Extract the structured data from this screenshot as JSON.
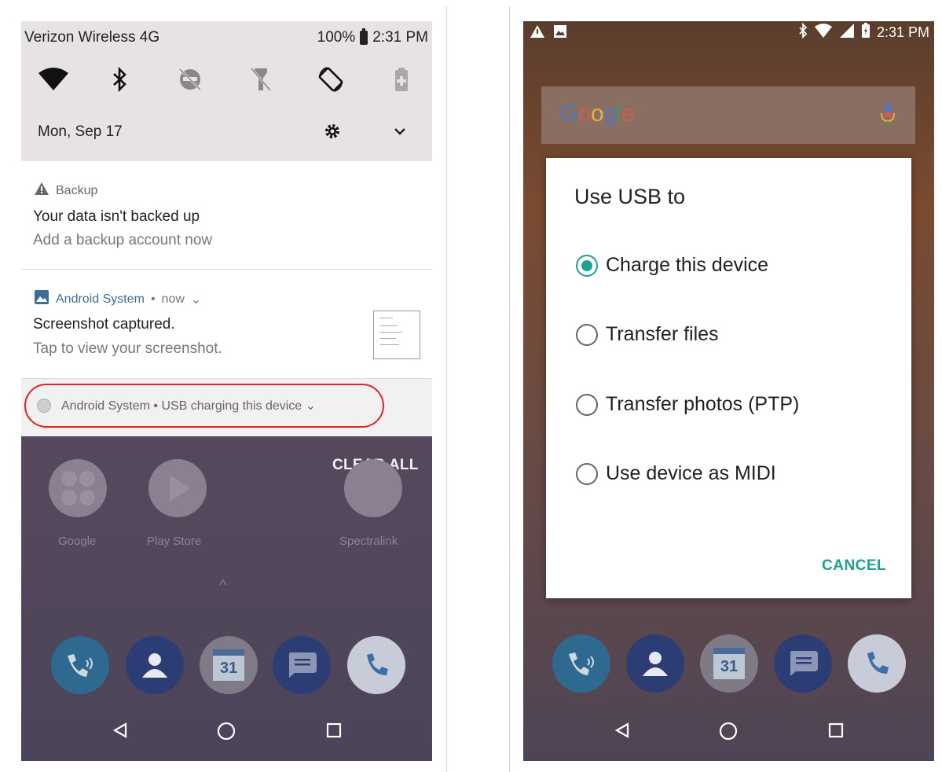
{
  "left": {
    "status": {
      "carrier": "Verizon Wireless 4G",
      "battery": "100%",
      "time": "2:31 PM"
    },
    "quick_settings": [
      "wifi-icon",
      "bluetooth-icon",
      "dnd-off-icon",
      "flashlight-off-icon",
      "auto-rotate-icon",
      "battery-saver-icon"
    ],
    "date": "Mon, Sep 17",
    "notifications": [
      {
        "app": "Backup",
        "title": "Your data isn't backed up",
        "text": "Add a backup account now"
      },
      {
        "app": "Android System",
        "time": "now",
        "title": "Screenshot captured.",
        "text": "Tap to view your screenshot."
      }
    ],
    "usb_notification": {
      "app": "Android System",
      "text": "USB charging this device"
    },
    "clear_all": "CLEAR ALL",
    "apps": [
      {
        "label": "Google"
      },
      {
        "label": "Play Store"
      },
      {
        "label": "Spectralink"
      }
    ],
    "calendar_day": "31"
  },
  "right": {
    "status": {
      "time": "2:31 PM"
    },
    "search_logo": "Google",
    "dialog": {
      "title": "Use USB to",
      "options": [
        {
          "label": "Charge this device",
          "selected": true
        },
        {
          "label": "Transfer files",
          "selected": false
        },
        {
          "label": "Transfer photos (PTP)",
          "selected": false
        },
        {
          "label": "Use device as MIDI",
          "selected": false
        }
      ],
      "cancel": "CANCEL"
    },
    "calendar_day": "31"
  },
  "colors": {
    "accent": "#1aa293",
    "highlight_ring": "#e32424",
    "link_blue": "#3a6f9c"
  }
}
